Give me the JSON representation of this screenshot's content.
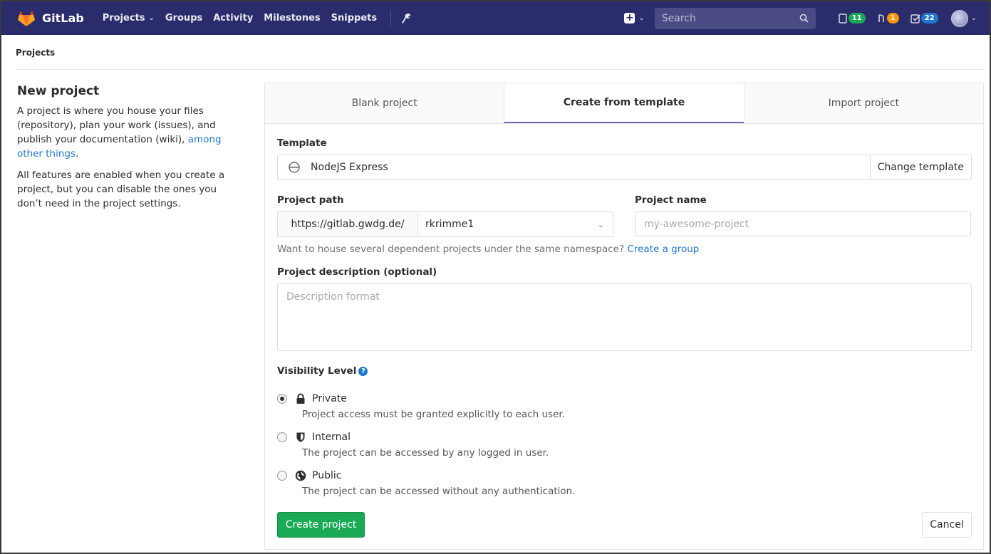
{
  "navbar": {
    "brand": "GitLab",
    "links": [
      {
        "label": "Projects",
        "dropdown": true
      },
      {
        "label": "Groups"
      },
      {
        "label": "Activity"
      },
      {
        "label": "Milestones"
      },
      {
        "label": "Snippets"
      }
    ],
    "search_placeholder": "Search",
    "counters": {
      "issues": "11",
      "merge_requests": "1",
      "todos": "22"
    }
  },
  "breadcrumb": "Projects",
  "sidebar": {
    "title": "New project",
    "para1_text": "A project is where you house your files (repository), plan your work (issues), and publish your documentation (wiki),",
    "para1_link": "among other things",
    "para1_end": ".",
    "para2": "All features are enabled when you create a project, but you can disable the ones you don’t need in the project settings."
  },
  "tabs": [
    {
      "label": "Blank project"
    },
    {
      "label": "Create from template"
    },
    {
      "label": "Import project"
    }
  ],
  "form": {
    "template_label": "Template",
    "template_name": "NodeJS Express",
    "change_template": "Change template",
    "project_path_label": "Project path",
    "path_prefix": "https://gitlab.gwdg.de/",
    "namespace": "rkrimme1",
    "project_name_label": "Project name",
    "project_name_placeholder": "my-awesome-project",
    "help_text": "Want to house several dependent projects under the same namespace?",
    "help_link": "Create a group",
    "description_label": "Project description (optional)",
    "description_placeholder": "Description format",
    "visibility_label": "Visibility Level",
    "visibility_options": [
      {
        "title": "Private",
        "desc": "Project access must be granted explicitly to each user.",
        "icon": "lock-icon",
        "selected": true
      },
      {
        "title": "Internal",
        "desc": "The project can be accessed by any logged in user.",
        "icon": "shield-icon",
        "selected": false
      },
      {
        "title": "Public",
        "desc": "The project can be accessed without any authentication.",
        "icon": "globe-icon",
        "selected": false
      }
    ],
    "create_button": "Create project",
    "cancel_button": "Cancel"
  },
  "colors": {
    "navbar_bg": "#2b2c6b",
    "success": "#1aaa55",
    "link": "#1f78d1",
    "active_tab_border": "#6b6bb3"
  }
}
